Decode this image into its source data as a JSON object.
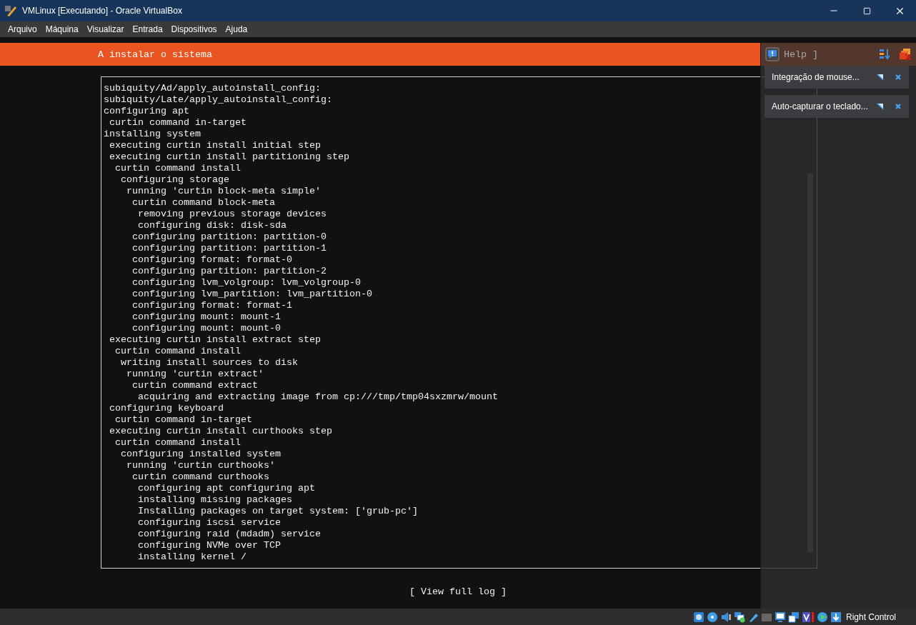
{
  "window": {
    "title": "VMLinux [Executando] - Oracle VirtualBox"
  },
  "menu": [
    "Arquivo",
    "Máquina",
    "Visualizar",
    "Entrada",
    "Dispositivos",
    "Ajuda"
  ],
  "installer": {
    "header": "A instalar o sistema",
    "help_partial": "Help ]",
    "log": [
      {
        "text": "subiquity/Ad/apply_autoinstall_config:"
      },
      {
        "text": "subiquity/Late/apply_autoinstall_config:"
      },
      {
        "text": "configuring apt",
        "children": [
          {
            "text": "curtin command in-target"
          }
        ]
      },
      {
        "text": "installing system",
        "children": [
          {
            "text": "executing curtin install initial step"
          },
          {
            "text": "executing curtin install partitioning step",
            "children": [
              {
                "text": "curtin command install",
                "children": [
                  {
                    "text": "configuring storage",
                    "children": [
                      {
                        "text": "running 'curtin block-meta simple'",
                        "children": [
                          {
                            "text": "curtin command block-meta",
                            "children": [
                              {
                                "text": "removing previous storage devices"
                              },
                              {
                                "text": "configuring disk: disk-sda"
                              }
                            ]
                          },
                          {
                            "text": "configuring partition: partition-0"
                          },
                          {
                            "text": "configuring partition: partition-1"
                          },
                          {
                            "text": "configuring format: format-0"
                          },
                          {
                            "text": "configuring partition: partition-2"
                          },
                          {
                            "text": "configuring lvm_volgroup: lvm_volgroup-0"
                          },
                          {
                            "text": "configuring lvm_partition: lvm_partition-0"
                          },
                          {
                            "text": "configuring format: format-1"
                          },
                          {
                            "text": "configuring mount: mount-1"
                          },
                          {
                            "text": "configuring mount: mount-0"
                          }
                        ]
                      }
                    ]
                  }
                ]
              }
            ]
          },
          {
            "text": "executing curtin install extract step",
            "children": [
              {
                "text": "curtin command install",
                "children": [
                  {
                    "text": "writing install sources to disk",
                    "children": [
                      {
                        "text": "running 'curtin extract'",
                        "children": [
                          {
                            "text": "curtin command extract",
                            "children": [
                              {
                                "text": "acquiring and extracting image from cp:///tmp/tmp04sxzmrw/mount"
                              }
                            ]
                          }
                        ]
                      }
                    ]
                  }
                ]
              }
            ]
          },
          {
            "text": "configuring keyboard",
            "children": [
              {
                "text": "curtin command in-target"
              }
            ]
          },
          {
            "text": "executing curtin install curthooks step",
            "children": [
              {
                "text": "curtin command install",
                "children": [
                  {
                    "text": "configuring installed system",
                    "children": [
                      {
                        "text": "running 'curtin curthooks'",
                        "children": [
                          {
                            "text": "curtin command curthooks",
                            "children": [
                              {
                                "text": "configuring apt configuring apt"
                              },
                              {
                                "text": "installing missing packages"
                              },
                              {
                                "text": "Installing packages on target system: ['grub-pc']"
                              },
                              {
                                "text": "configuring iscsi service"
                              },
                              {
                                "text": "configuring raid (mdadm) service"
                              },
                              {
                                "text": "configuring NVMe over TCP"
                              },
                              {
                                "text": "installing kernel /"
                              }
                            ]
                          }
                        ]
                      }
                    ]
                  }
                ]
              }
            ]
          }
        ]
      }
    ],
    "view_log_button": "[ View full log ]"
  },
  "notifications": [
    {
      "text": "Integração de mouse..."
    },
    {
      "text": "Auto-capturar o teclado..."
    }
  ],
  "status_bar": {
    "host_key": "Right Control"
  }
}
